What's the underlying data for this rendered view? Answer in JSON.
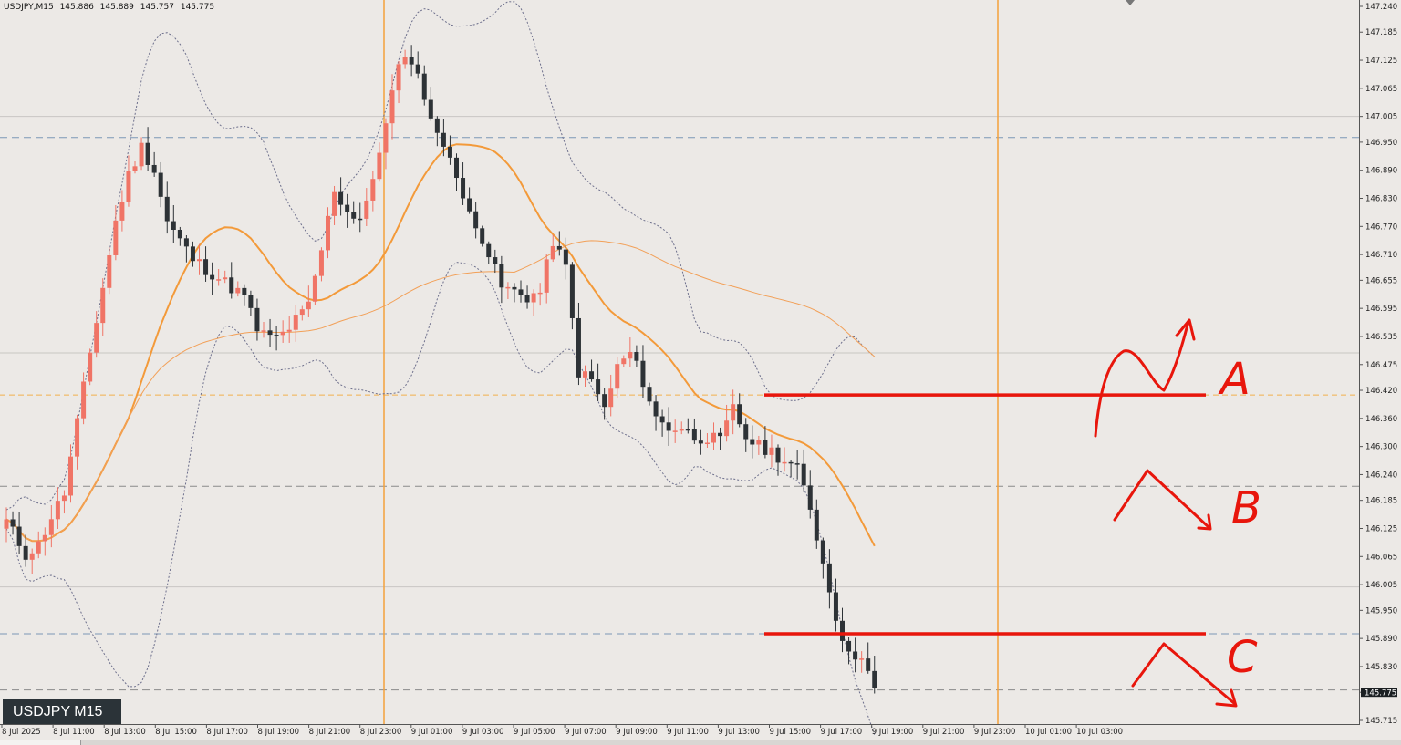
{
  "header": {
    "symbol": "USDJPY,M15",
    "open": "145.886",
    "high": "145.889",
    "low": "145.757",
    "close": "145.775"
  },
  "badge": "USDJPY M15",
  "colors": {
    "background": "#ece9e6",
    "bull_candle": "#f07466",
    "bear_candle": "#2d3236",
    "ma_fast": "#f39a3a",
    "ma_slow": "#f2a058",
    "bollinger": "#6d6f8c",
    "session_line": "#f3a13c",
    "annotation": "#e8160c",
    "dashed_blue": "#7b97b6",
    "dashed_orange": "#f1b04e"
  },
  "chart_data": {
    "type": "candlestick",
    "ylim": [
      145.715,
      147.24
    ],
    "y_ticks": [
      "147.240",
      "147.185",
      "147.125",
      "147.065",
      "147.005",
      "146.950",
      "146.890",
      "146.830",
      "146.770",
      "146.710",
      "146.655",
      "146.595",
      "146.535",
      "146.475",
      "146.420",
      "146.360",
      "146.300",
      "146.240",
      "146.185",
      "146.125",
      "146.065",
      "146.005",
      "145.950",
      "145.890",
      "145.830",
      "145.775",
      "145.715"
    ],
    "current_price": "145.775",
    "x_ticks": [
      "8 Jul 2025",
      "8 Jul 11:00",
      "8 Jul 13:00",
      "8 Jul 15:00",
      "8 Jul 17:00",
      "8 Jul 19:00",
      "8 Jul 21:00",
      "8 Jul 23:00",
      "9 Jul 01:00",
      "9 Jul 03:00",
      "9 Jul 05:00",
      "9 Jul 07:00",
      "9 Jul 09:00",
      "9 Jul 11:00",
      "9 Jul 13:00",
      "9 Jul 15:00",
      "9 Jul 17:00",
      "9 Jul 19:00",
      "9 Jul 21:00",
      "9 Jul 23:00",
      "10 Jul 01:00",
      "10 Jul 03:00"
    ],
    "session_separators": [
      "8 Jul 23:00",
      "9 Jul 23:00"
    ],
    "horizontal_levels": [
      {
        "price": 147.005,
        "style": "solid-gray"
      },
      {
        "price": 146.96,
        "style": "dashed-blue"
      },
      {
        "price": 146.5,
        "style": "solid-gray"
      },
      {
        "price": 146.41,
        "style": "dashed-orange"
      },
      {
        "price": 146.215,
        "style": "dashed-gray"
      },
      {
        "price": 146.0,
        "style": "solid-gray"
      },
      {
        "price": 145.9,
        "style": "dashed-blue"
      },
      {
        "price": 145.78,
        "style": "dashed-gray"
      }
    ],
    "close_path": [
      [
        0,
        146.14
      ],
      [
        3,
        146.07
      ],
      [
        5,
        146.09
      ],
      [
        7,
        146.15
      ],
      [
        9,
        146.2
      ],
      [
        11,
        146.35
      ],
      [
        13,
        146.5
      ],
      [
        15,
        146.64
      ],
      [
        17,
        146.78
      ],
      [
        19,
        146.88
      ],
      [
        21,
        146.94
      ],
      [
        23,
        146.89
      ],
      [
        25,
        146.78
      ],
      [
        27,
        146.74
      ],
      [
        29,
        146.7
      ],
      [
        31,
        146.68
      ],
      [
        33,
        146.66
      ],
      [
        35,
        146.64
      ],
      [
        37,
        146.62
      ],
      [
        39,
        146.55
      ],
      [
        41,
        146.53
      ],
      [
        43,
        146.54
      ],
      [
        45,
        146.57
      ],
      [
        47,
        146.6
      ],
      [
        49,
        146.72
      ],
      [
        51,
        146.85
      ],
      [
        53,
        146.8
      ],
      [
        55,
        146.79
      ],
      [
        57,
        146.86
      ],
      [
        59,
        147.0
      ],
      [
        61,
        147.11
      ],
      [
        63,
        147.13
      ],
      [
        65,
        147.05
      ],
      [
        67,
        146.96
      ],
      [
        69,
        146.93
      ],
      [
        71,
        146.82
      ],
      [
        73,
        146.78
      ],
      [
        75,
        146.71
      ],
      [
        77,
        146.64
      ],
      [
        79,
        146.63
      ],
      [
        81,
        146.62
      ],
      [
        83,
        146.63
      ],
      [
        85,
        146.74
      ],
      [
        87,
        146.68
      ],
      [
        89,
        146.46
      ],
      [
        91,
        146.44
      ],
      [
        93,
        146.38
      ],
      [
        95,
        146.47
      ],
      [
        97,
        146.5
      ],
      [
        99,
        146.44
      ],
      [
        101,
        146.36
      ],
      [
        103,
        146.34
      ],
      [
        105,
        146.34
      ],
      [
        107,
        146.32
      ],
      [
        109,
        146.32
      ],
      [
        111,
        146.31
      ],
      [
        113,
        146.38
      ],
      [
        115,
        146.32
      ],
      [
        117,
        146.3
      ],
      [
        119,
        146.29
      ],
      [
        121,
        146.27
      ],
      [
        123,
        146.25
      ],
      [
        125,
        146.17
      ],
      [
        127,
        146.05
      ],
      [
        129,
        145.94
      ],
      [
        131,
        145.85
      ],
      [
        133,
        145.86
      ],
      [
        135,
        145.775
      ]
    ],
    "annotations": [
      {
        "label": "A",
        "level": 146.41,
        "color": "#e8160c"
      },
      {
        "label": "B",
        "color": "#e8160c"
      },
      {
        "label": "C",
        "level": 145.9,
        "color": "#e8160c"
      }
    ]
  }
}
